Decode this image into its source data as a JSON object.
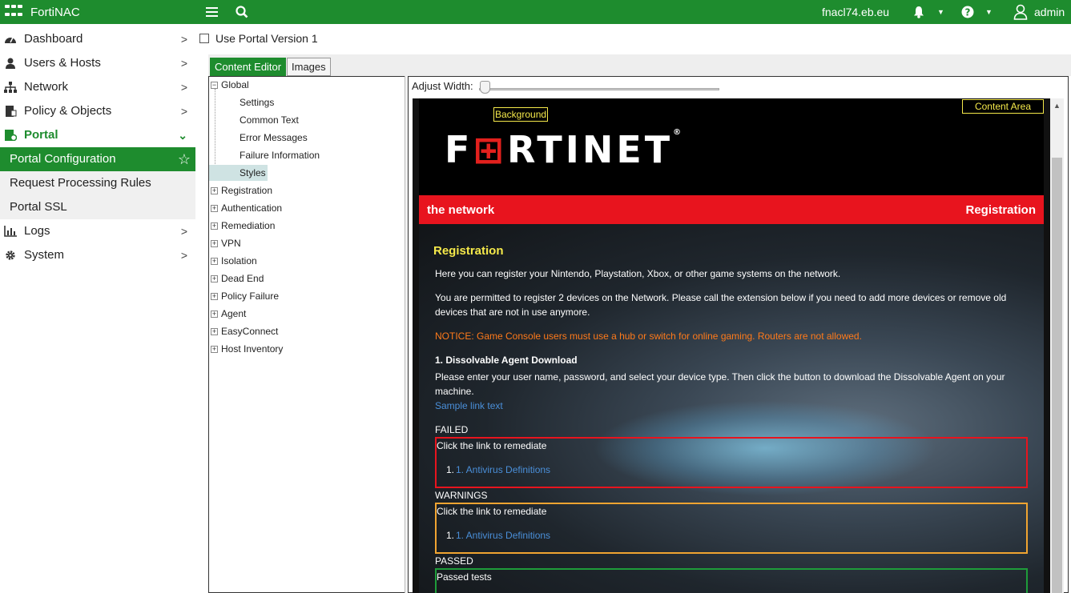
{
  "app": {
    "title": "FortiNAC"
  },
  "topbar": {
    "hostname": "fnacl74.eb.eu",
    "username": "admin"
  },
  "sidebar": {
    "items": [
      {
        "label": "Dashboard"
      },
      {
        "label": "Users & Hosts"
      },
      {
        "label": "Network"
      },
      {
        "label": "Policy & Objects"
      },
      {
        "label": "Portal"
      }
    ],
    "portal_sub": [
      {
        "label": "Portal Configuration"
      },
      {
        "label": "Request Processing Rules"
      },
      {
        "label": "Portal SSL"
      }
    ],
    "after": [
      {
        "label": "Logs"
      },
      {
        "label": "System"
      }
    ]
  },
  "portal_version": {
    "label": "Use Portal Version 1",
    "checked": false
  },
  "tabs": [
    {
      "label": "Content Editor"
    },
    {
      "label": "Images"
    }
  ],
  "tree": {
    "global": "Global",
    "global_children": [
      "Settings",
      "Common Text",
      "Error Messages",
      "Failure Information",
      "Styles"
    ],
    "selected": "Styles",
    "nodes": [
      "Registration",
      "Authentication",
      "Remediation",
      "VPN",
      "Isolation",
      "Dead End",
      "Policy Failure",
      "Agent",
      "EasyConnect",
      "Host Inventory"
    ]
  },
  "preview": {
    "adjust_label": "Adjust Width:",
    "background_label": "Background",
    "content_area_label": "Content Area",
    "brand": "FRTINET",
    "redbar_left": "the network",
    "redbar_right": "Registration",
    "heading": "Registration",
    "p1": "Here you can register your Nintendo, Playstation, Xbox, or other game systems on the network.",
    "p2a": "You are permitted to register 2 devices on the Network. Please call the extension below if you need to add more devices or remove old",
    "p2b": "devices that are not in use anymore.",
    "notice": "NOTICE: Game Console users must use a hub or switch for online gaming. Routers are not allowed.",
    "step": "1. Dissolvable Agent Download",
    "p3a": "Please enter your user name, password, and select your device type. Then click the button to download the Dissolvable Agent on your",
    "p3b": "machine.",
    "sample_link": "Sample link text",
    "failed_label": "FAILED",
    "failed_text": "Click the link to remediate",
    "failed_item": "1. Antivirus Definitions",
    "warnings_label": "WARNINGS",
    "warn_text": "Click the link to remediate",
    "warn_item": "1. Antivirus Definitions",
    "passed_label": "PASSED",
    "passed_text": "Passed tests"
  },
  "colors": {
    "brand_green": "#1e8c2e",
    "fortinet_red": "#e8141e",
    "yellow": "#f5e94a",
    "orange": "#ff7a1a"
  }
}
